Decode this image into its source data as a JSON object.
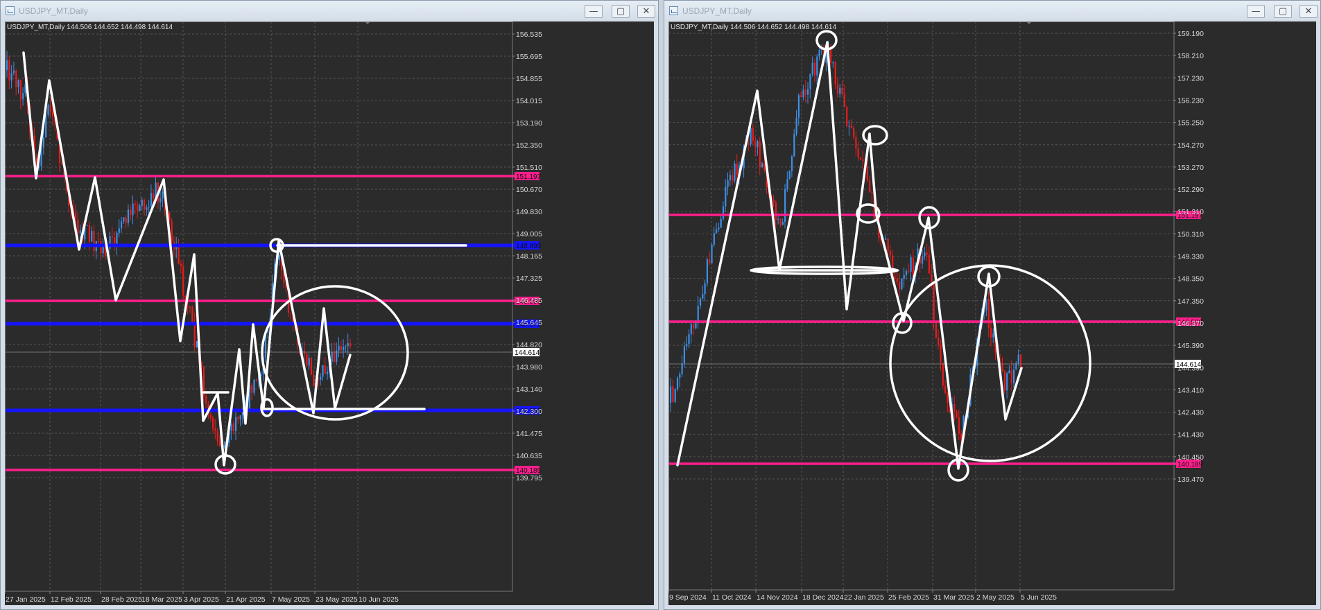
{
  "windows": [
    {
      "id": "left",
      "title": "USDJPY_MT,Daily",
      "chart_info": "USDJPY_MT,Daily  144.506 144.652 144.498 144.614",
      "current_price": "144.614",
      "price_scale": [
        "156.535",
        "155.695",
        "154.855",
        "154.015",
        "153.190",
        "152.350",
        "151.510",
        "150.670",
        "149.830",
        "149.005",
        "148.165",
        "147.325",
        "146.485",
        "145.645",
        "144.820",
        "143.980",
        "143.140",
        "142.300",
        "141.475",
        "140.635",
        "139.795"
      ],
      "date_scale": [
        "27 Jan 2025",
        "12 Feb 2025",
        "28 Feb 2025",
        "18 Mar 2025",
        "3 Apr 2025",
        "21 Apr 2025",
        "7 May 2025",
        "23 May 2025",
        "10 Jun 2025"
      ],
      "horizontal_levels": [
        {
          "label": "151.197",
          "color": "#ff1e8c"
        },
        {
          "label": "148.893",
          "color": "#1414ff"
        },
        {
          "label": "146.500",
          "color": "#ff1e8c"
        },
        {
          "label": "145.672",
          "color": "#1414ff"
        },
        {
          "label": "142.556",
          "color": "#1414ff"
        },
        {
          "label": "140.189",
          "color": "#ff1e8c"
        }
      ],
      "window_buttons": [
        "—",
        "▢",
        "✕"
      ]
    },
    {
      "id": "right",
      "title": "USDJPY_MT,Daily",
      "chart_info": "USDJPY_MT,Daily  144.506 144.652 144.498 144.614",
      "current_price": "144.614",
      "price_scale": [
        "159.190",
        "158.210",
        "157.230",
        "156.230",
        "155.250",
        "154.270",
        "153.270",
        "152.290",
        "151.310",
        "150.310",
        "149.330",
        "148.350",
        "147.350",
        "146.370",
        "145.390",
        "144.390",
        "143.410",
        "142.430",
        "141.430",
        "140.450",
        "139.470"
      ],
      "date_scale": [
        "9 Sep 2024",
        "11 Oct 2024",
        "14 Nov 2024",
        "18 Dec 2024",
        "22 Jan 2025",
        "25 Feb 2025",
        "31 Mar 2025",
        "2 May 2025",
        "5 Jun 2025"
      ],
      "horizontal_levels": [
        {
          "label": "151.197",
          "color": "#ff1e8c"
        },
        {
          "label": "146.500",
          "color": "#ff1e8c"
        },
        {
          "label": "140.189",
          "color": "#ff1e8c"
        }
      ],
      "window_buttons": [
        "—",
        "▢",
        "✕"
      ]
    }
  ],
  "colors": {
    "chart_bg": "#2b2b2b",
    "bull_candle": "#3d8fe6",
    "bear_candle": "#e81c1c",
    "annotation": "#ffffff"
  }
}
